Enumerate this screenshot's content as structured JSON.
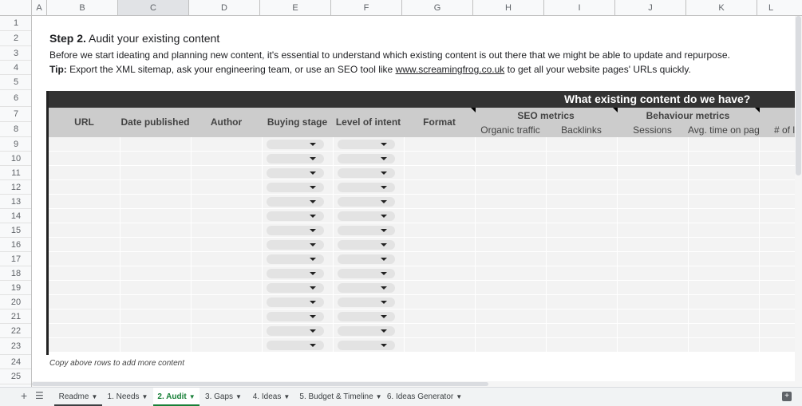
{
  "columns": [
    "A",
    "B",
    "C",
    "D",
    "E",
    "F",
    "G",
    "H",
    "I",
    "J",
    "K",
    "L"
  ],
  "rows": [
    "1",
    "2",
    "3",
    "4",
    "5",
    "6",
    "7",
    "8",
    "9",
    "10",
    "11",
    "12",
    "13",
    "14",
    "15",
    "16",
    "17",
    "18",
    "19",
    "20",
    "21",
    "22",
    "23",
    "24",
    "25"
  ],
  "step": {
    "bold": "Step 2.",
    "rest": " Audit your existing content"
  },
  "intro": "Before we start ideating and planning new content, it's essential to understand which existing content is out there that we might be able to update and repurpose.",
  "tip": {
    "label": "Tip:",
    "before": " Export the XML sitemap, ask your engineering team, or use an SEO tool like ",
    "link": "www.screamingfrog.co.uk",
    "after": " to get all your website pages' URLs quickly."
  },
  "table": {
    "band_title": "What existing content do we have?",
    "headers": {
      "url": "URL",
      "date": "Date published",
      "author": "Author",
      "buying": "Buying stage",
      "intent": "Level of intent",
      "format": "Format"
    },
    "groups": {
      "seo": "SEO metrics",
      "behaviour": "Behaviour metrics"
    },
    "subheaders": {
      "organic": "Organic traffic",
      "backlinks": "Backlinks",
      "sessions": "Sessions",
      "avgtime": "Avg. time on page",
      "num": "# of l"
    },
    "data_rows": 15
  },
  "copy_note": "Copy above rows to add more content",
  "tabs": [
    {
      "label": "Readme"
    },
    {
      "label": "1. Needs"
    },
    {
      "label": "2. Audit",
      "active": true
    },
    {
      "label": "3. Gaps"
    },
    {
      "label": "4. Ideas"
    },
    {
      "label": "5. Budget & Timeline"
    },
    {
      "label": "6. Ideas Generator"
    }
  ],
  "colors": {
    "band": "#333333",
    "header": "#cccccc",
    "cell": "#f3f3f3",
    "active_tab": "#188038"
  }
}
